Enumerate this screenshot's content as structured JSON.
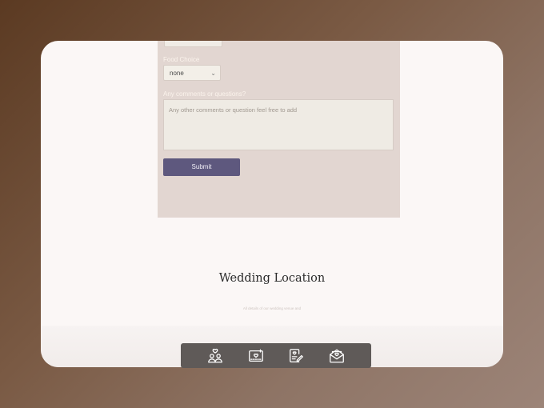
{
  "form": {
    "food_label": "Food Choice",
    "food_select_value": "none",
    "comments_label": "Any comments or questions?",
    "comments_placeholder": "Any other comments or question feel free to add",
    "submit_label": "Submit"
  },
  "location": {
    "title": "Wedding Location",
    "subtitle": "All details of our wedding venue and"
  },
  "nav": {
    "items": [
      {
        "icon": "couple-icon"
      },
      {
        "icon": "photo-heart-icon"
      },
      {
        "icon": "rsvp-form-icon"
      },
      {
        "icon": "envelope-heart-icon"
      }
    ]
  },
  "colors": {
    "panel": "#e2d6d1",
    "submit": "#5e587e",
    "nav": "#5f5a58"
  }
}
